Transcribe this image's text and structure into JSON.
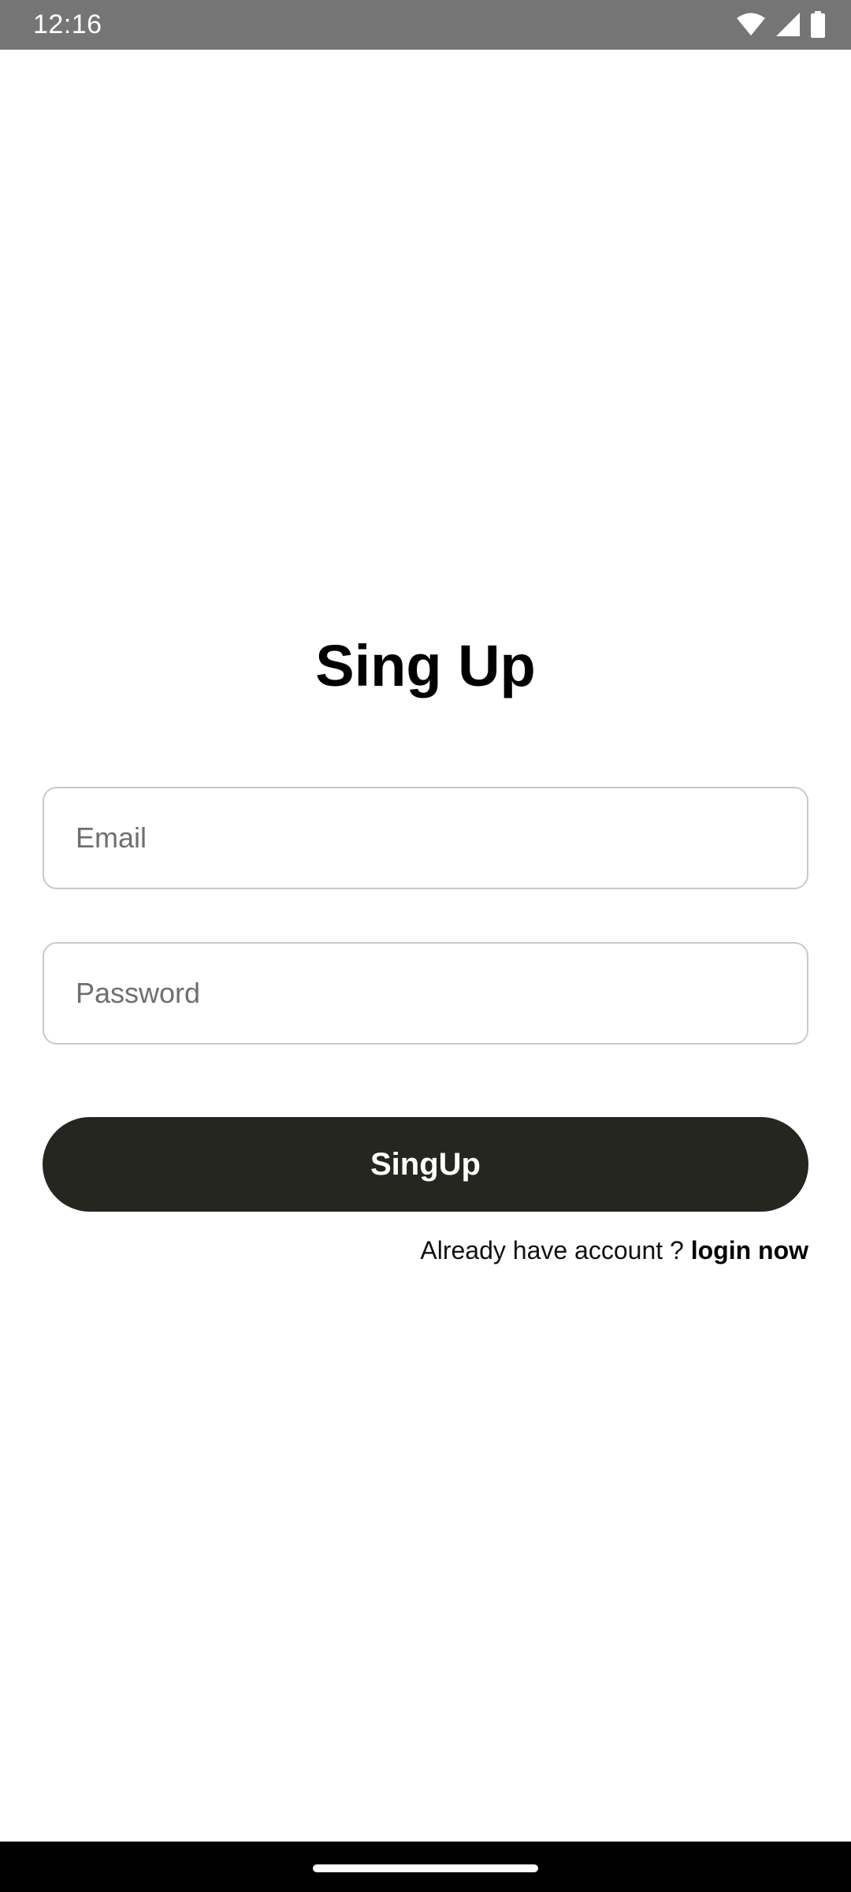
{
  "status_bar": {
    "time": "12:16",
    "icons": [
      "wifi-icon",
      "signal-icon",
      "battery-icon"
    ]
  },
  "page": {
    "title": "Sing Up"
  },
  "form": {
    "email_placeholder": "Email",
    "password_placeholder": "Password",
    "submit_label": "SingUp"
  },
  "login_prompt": {
    "text": "Already have account ? ",
    "link_label": "login now"
  },
  "colors": {
    "status_bar": "#757575",
    "button": "#24261f",
    "field_border": "#c9c9c9"
  }
}
